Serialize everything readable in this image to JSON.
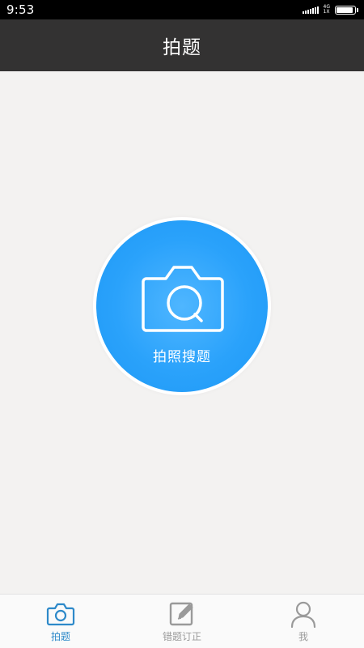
{
  "status_bar": {
    "time": "9:53",
    "net_top": "4G",
    "net_bottom": "1X"
  },
  "header": {
    "title": "拍题"
  },
  "main": {
    "camera_button_label": "拍照搜题"
  },
  "bottom_nav": {
    "items": [
      {
        "label": "拍题",
        "icon": "camera-icon",
        "active": true
      },
      {
        "label": "错题订正",
        "icon": "edit-icon",
        "active": false
      },
      {
        "label": "我",
        "icon": "person-icon",
        "active": false
      }
    ]
  },
  "colors": {
    "status_bar_bg": "#000000",
    "title_bar_bg": "#333232",
    "page_bg": "#f3f2f1",
    "accent_blue": "#2aa2fb",
    "nav_active": "#2d89c9",
    "nav_inactive": "#9a9a9a"
  }
}
